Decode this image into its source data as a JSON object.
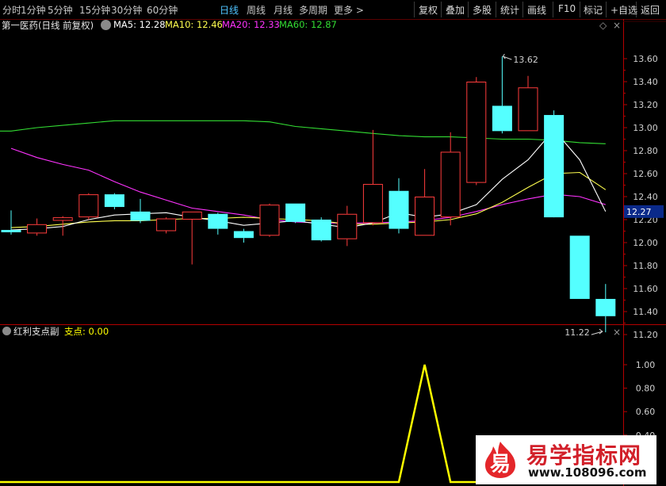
{
  "toolbar": {
    "periods": [
      "分时",
      "1分钟",
      "5分钟",
      "15分钟",
      "30分钟",
      "60分钟",
      "日线",
      "周线",
      "月线",
      "多周期",
      "更多 >"
    ],
    "active_period": "日线",
    "buttons": [
      "复权",
      "叠加",
      "多股",
      "统计",
      "画线",
      "F10",
      "标记",
      "+自选",
      "返回"
    ]
  },
  "header": {
    "stock_title": "第一医药(日线 前复权)",
    "ma5_label": "MA5: 12.28",
    "ma10_label": "MA10: 12.46",
    "ma20_label": "MA20: 12.33",
    "ma60_label": "MA60: 12.87"
  },
  "colors": {
    "up": "#ff3c3c",
    "down": "#54ffff",
    "ma5": "#ffffff",
    "ma10": "#ffff4f",
    "ma20": "#ff33ff",
    "ma60": "#33dd33",
    "axis": "#b40000",
    "sub_line": "#ffff00"
  },
  "sub_header": {
    "title": "红利支点副",
    "value_label": "支点: 0.00"
  },
  "annotations": {
    "high": "13.62",
    "low": "11.22",
    "current_price": "12.27"
  },
  "watermark": {
    "logo_char": "易",
    "title": "易学指标网",
    "url": "www.108096.com"
  },
  "chart_data": [
    {
      "type": "candlestick",
      "title": "第一医药(日线 前复权)",
      "yticks": [
        11.2,
        11.4,
        11.6,
        11.8,
        12.0,
        12.2,
        12.4,
        12.6,
        12.8,
        13.0,
        13.2,
        13.4,
        13.6
      ],
      "ylim": [
        11.14,
        13.67
      ],
      "candles": [
        {
          "o": 12.11,
          "h": 12.28,
          "l": 12.07,
          "c": 12.09
        },
        {
          "o": 12.08,
          "h": 12.21,
          "l": 12.06,
          "c": 12.16
        },
        {
          "o": 12.19,
          "h": 12.23,
          "l": 12.06,
          "c": 12.22
        },
        {
          "o": 12.22,
          "h": 12.43,
          "l": 12.2,
          "c": 12.42
        },
        {
          "o": 12.42,
          "h": 12.43,
          "l": 12.29,
          "c": 12.31
        },
        {
          "o": 12.27,
          "h": 12.38,
          "l": 12.17,
          "c": 12.19
        },
        {
          "o": 12.1,
          "h": 12.22,
          "l": 12.08,
          "c": 12.21
        },
        {
          "o": 12.2,
          "h": 12.27,
          "l": 11.81,
          "c": 12.27
        },
        {
          "o": 12.25,
          "h": 12.26,
          "l": 12.07,
          "c": 12.12
        },
        {
          "o": 12.1,
          "h": 12.12,
          "l": 12.0,
          "c": 12.04
        },
        {
          "o": 12.06,
          "h": 12.34,
          "l": 12.05,
          "c": 12.33
        },
        {
          "o": 12.34,
          "h": 12.34,
          "l": 12.17,
          "c": 12.18
        },
        {
          "o": 12.2,
          "h": 12.22,
          "l": 12.01,
          "c": 12.02
        },
        {
          "o": 12.03,
          "h": 12.32,
          "l": 11.97,
          "c": 12.25
        },
        {
          "o": 12.17,
          "h": 12.98,
          "l": 12.15,
          "c": 12.51
        },
        {
          "o": 12.45,
          "h": 12.56,
          "l": 12.08,
          "c": 12.12
        },
        {
          "o": 12.06,
          "h": 12.64,
          "l": 12.06,
          "c": 12.4
        },
        {
          "o": 12.22,
          "h": 12.96,
          "l": 12.15,
          "c": 12.79
        },
        {
          "o": 12.52,
          "h": 13.44,
          "l": 12.5,
          "c": 13.4
        },
        {
          "o": 13.19,
          "h": 13.62,
          "l": 12.95,
          "c": 12.97
        },
        {
          "o": 12.97,
          "h": 13.45,
          "l": 12.97,
          "c": 13.35
        },
        {
          "o": 13.11,
          "h": 13.15,
          "l": 12.23,
          "c": 12.22
        },
        {
          "o": 12.06,
          "h": 12.06,
          "l": 11.51,
          "c": 11.51
        },
        {
          "o": 11.51,
          "h": 11.64,
          "l": 11.22,
          "c": 11.36
        }
      ],
      "series": [
        {
          "name": "MA5",
          "values": [
            12.11,
            12.12,
            12.14,
            12.2,
            12.24,
            12.25,
            12.26,
            12.22,
            12.19,
            12.15,
            12.17,
            12.19,
            12.16,
            12.13,
            12.17,
            12.26,
            12.22,
            12.25,
            12.33,
            12.55,
            12.72,
            12.98,
            12.72,
            12.27
          ]
        },
        {
          "name": "MA10",
          "values": [
            12.13,
            12.14,
            12.16,
            12.18,
            12.19,
            12.19,
            12.2,
            12.21,
            12.21,
            12.22,
            12.21,
            12.2,
            12.19,
            12.16,
            12.16,
            12.17,
            12.18,
            12.2,
            12.25,
            12.35,
            12.48,
            12.6,
            12.61,
            12.46
          ]
        },
        {
          "name": "MA20",
          "values": [
            12.82,
            12.74,
            12.68,
            12.63,
            12.53,
            12.44,
            12.37,
            12.3,
            12.27,
            12.24,
            12.2,
            12.18,
            12.17,
            12.17,
            12.17,
            12.18,
            12.19,
            12.22,
            12.27,
            12.33,
            12.38,
            12.42,
            12.4,
            12.33
          ]
        },
        {
          "name": "MA60",
          "values": [
            12.97,
            13.0,
            13.02,
            13.04,
            13.06,
            13.06,
            13.06,
            13.06,
            13.06,
            13.06,
            13.05,
            13.01,
            12.99,
            12.97,
            12.95,
            12.93,
            12.92,
            12.92,
            12.91,
            12.9,
            12.9,
            12.89,
            12.87,
            12.86
          ]
        }
      ]
    },
    {
      "type": "line",
      "title": "红利支点副",
      "yticks": [
        0.4,
        0.6,
        0.8,
        1.0
      ],
      "ylim": [
        0,
        1.06
      ],
      "series": [
        {
          "name": "支点",
          "values": [
            0,
            0,
            0,
            0,
            0,
            0,
            0,
            0,
            0,
            0,
            0,
            0,
            0,
            0,
            0,
            0,
            1,
            0,
            0,
            0,
            0,
            0,
            0,
            0
          ]
        }
      ]
    }
  ]
}
